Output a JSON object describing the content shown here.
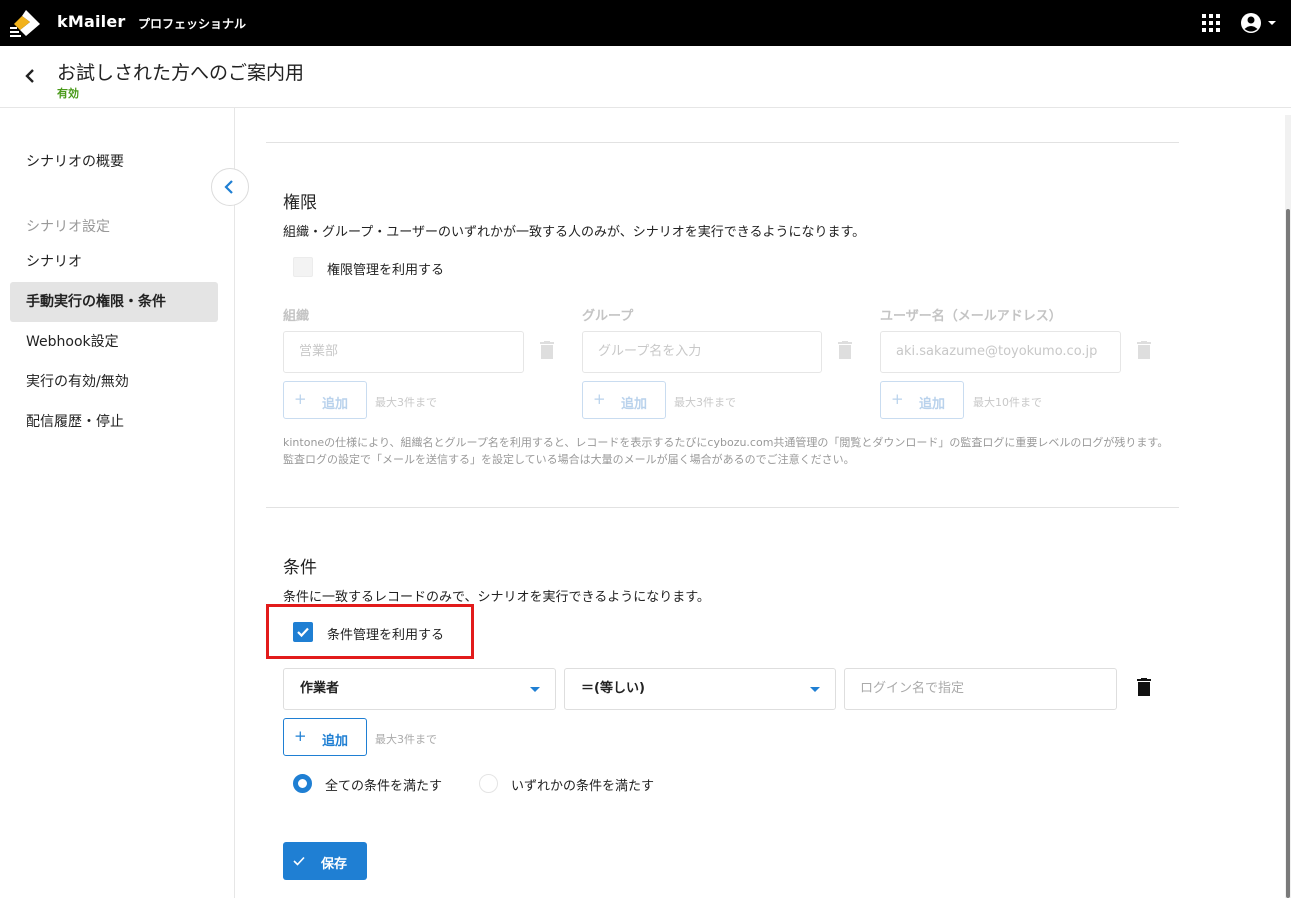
{
  "app": {
    "brand": "kMailer",
    "edition": "プロフェッショナル"
  },
  "header": {
    "title": "お試しされた方へのご案内用",
    "status": "有効"
  },
  "sidebar": {
    "overview": "シナリオの概要",
    "settings_heading": "シナリオ設定",
    "items": [
      {
        "label": "シナリオ"
      },
      {
        "label": "手動実行の権限・条件"
      },
      {
        "label": "Webhook設定"
      },
      {
        "label": "実行の有効/無効"
      },
      {
        "label": "配信履歴・停止"
      }
    ]
  },
  "permissions": {
    "heading": "権限",
    "description": "組織・グループ・ユーザーのいずれかが一致する人のみが、シナリオを実行できるようになります。",
    "checkbox_label": "権限管理を利用する",
    "checked": false,
    "columns": [
      {
        "label": "組織",
        "placeholder": "営業部",
        "add_label": "追加",
        "limit": "最大3件まで"
      },
      {
        "label": "グループ",
        "placeholder": "グループ名を入力",
        "add_label": "追加",
        "limit": "最大3件まで"
      },
      {
        "label": "ユーザー名（メールアドレス）",
        "placeholder": "aki.sakazume@toyokumo.co.jp",
        "add_label": "追加",
        "limit": "最大10件まで"
      }
    ],
    "footnote": "kintoneの仕様により、組織名とグループ名を利用すると、レコードを表示するたびにcybozu.com共通管理の「閲覧とダウンロード」の監査ログに重要レベルのログが残ります。監査ログの設定で「メールを送信する」を設定している場合は大量のメールが届く場合があるのでご注意ください。"
  },
  "conditions": {
    "heading": "条件",
    "description": "条件に一致するレコードのみで、シナリオを実行できるようになります。",
    "checkbox_label": "条件管理を利用する",
    "checked": true,
    "field_select": "作業者",
    "operator_select": "＝(等しい)",
    "value_placeholder": "ログイン名で指定",
    "add_label": "追加",
    "limit": "最大3件まで",
    "match_options": [
      {
        "label": "全ての条件を満たす",
        "selected": true
      },
      {
        "label": "いずれかの条件を満たす",
        "selected": false
      }
    ]
  },
  "save_label": "保存",
  "colors": {
    "accent": "#1f7fd3",
    "status_green": "#4a9a1a",
    "highlight_red": "#e21b1b",
    "topbar": "#000000"
  }
}
